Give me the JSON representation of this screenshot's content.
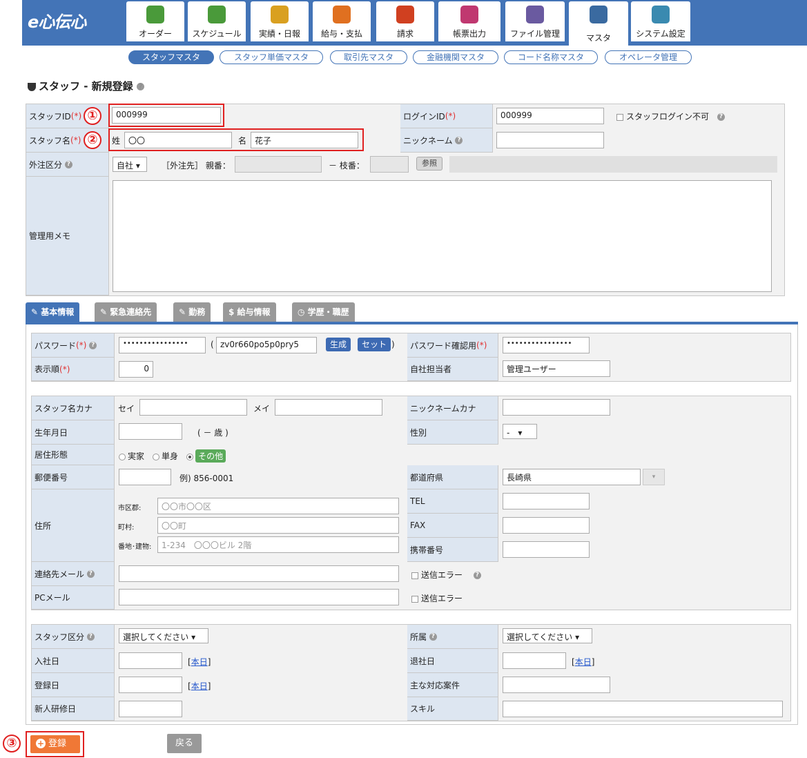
{
  "app": {
    "logo": "e心伝心"
  },
  "nav": [
    {
      "label": "オーダー",
      "icon": "handshake-icon",
      "color": "#4a9a3a"
    },
    {
      "label": "スケジュール",
      "icon": "calendar-icon",
      "color": "#4a9a3a"
    },
    {
      "label": "実績・日報",
      "icon": "book-icon",
      "color": "#d9a020"
    },
    {
      "label": "給与・支払",
      "icon": "person-money-icon",
      "color": "#e07020"
    },
    {
      "label": "請求",
      "icon": "building-money-icon",
      "color": "#d04020"
    },
    {
      "label": "帳票出力",
      "icon": "papers-icon",
      "color": "#c03870"
    },
    {
      "label": "ファイル管理",
      "icon": "folder-icon",
      "color": "#6a5aa0"
    },
    {
      "label": "マスタ",
      "icon": "database-icon",
      "color": "#3a6aa0"
    },
    {
      "label": "システム設定",
      "icon": "monitor-gear-icon",
      "color": "#3a8ab0"
    }
  ],
  "subnav": [
    "スタッフマスタ",
    "スタッフ単価マスタ",
    "取引先マスタ",
    "金融機関マスタ",
    "コード名称マスタ",
    "オペレータ管理"
  ],
  "page_title": "スタッフ - 新規登録",
  "help": "?",
  "req": "(*)",
  "top": {
    "staff_id_label": "スタッフID",
    "staff_id_value": "000999",
    "login_id_label": "ログインID",
    "login_id_value": "000999",
    "login_disable": "スタッフログイン不可",
    "staff_name_label": "スタッフ名",
    "sei": "姓",
    "sei_value": "〇〇",
    "mei": "名",
    "mei_value": "花子",
    "nickname_label": "ニックネーム",
    "outsource_label": "外注区分",
    "outsource_value": "自社 ▾",
    "outsource_dest": "［外注先］ 親番：",
    "branch": "－ 枝番：",
    "ref_btn": "参照",
    "memo_label": "管理用メモ"
  },
  "tabs": [
    "基本情報",
    "緊急連絡先",
    "勤務",
    "給与情報",
    "学歴・職歴"
  ],
  "basic": {
    "pw_label": "パスワード",
    "pw_value": "••••••••••••••••",
    "pw_gen": "zv0r660po5p0pry5",
    "gen_btn": "生成",
    "set_btn": "セット",
    "pw_conf_label": "パスワード確認用",
    "pw_conf_value": "••••••••••••••••",
    "order_label": "表示順",
    "order_value": "0",
    "manager_label": "自社担当者",
    "manager_value": "管理ユーザー",
    "kana_label": "スタッフ名カナ",
    "sei_k": "セイ",
    "mei_k": "メイ",
    "nick_kana_label": "ニックネームカナ",
    "birth_label": "生年月日",
    "age": "( － 歳 )",
    "sex_label": "性別",
    "sex_value": "-　▾",
    "res_label": "居住形態",
    "res_opts": [
      "実家",
      "単身",
      "その他"
    ],
    "zip_label": "郵便番号",
    "zip_example": "例) 856-0001",
    "pref_label": "都道府県",
    "pref_value": "長崎県",
    "addr_label": "住所",
    "city_label": "市区郡:",
    "city_ph": "〇〇市〇〇区",
    "town_label": "町村:",
    "town_ph": "〇〇町",
    "bldg_label": "番地･建物:",
    "bldg_ph": "1-234　〇〇〇ビル 2階",
    "tel_label": "TEL",
    "fax_label": "FAX",
    "mobile_label": "携帯番号",
    "mail_label": "連絡先メール",
    "send_err": "送信エラー",
    "pcmail_label": "PCメール",
    "kubun_label": "スタッフ区分",
    "kubun_value": "選択してください ▾",
    "dept_label": "所属",
    "dept_value": "選択してください ▾",
    "join_label": "入社日",
    "today": "本日",
    "leave_label": "退社日",
    "reg_label": "登録日",
    "case_label": "主な対応案件",
    "training_label": "新人研修日",
    "skill_label": "スキル"
  },
  "footer": {
    "register": "登録",
    "back": "戻る"
  },
  "markers": [
    "①",
    "②",
    "③"
  ]
}
